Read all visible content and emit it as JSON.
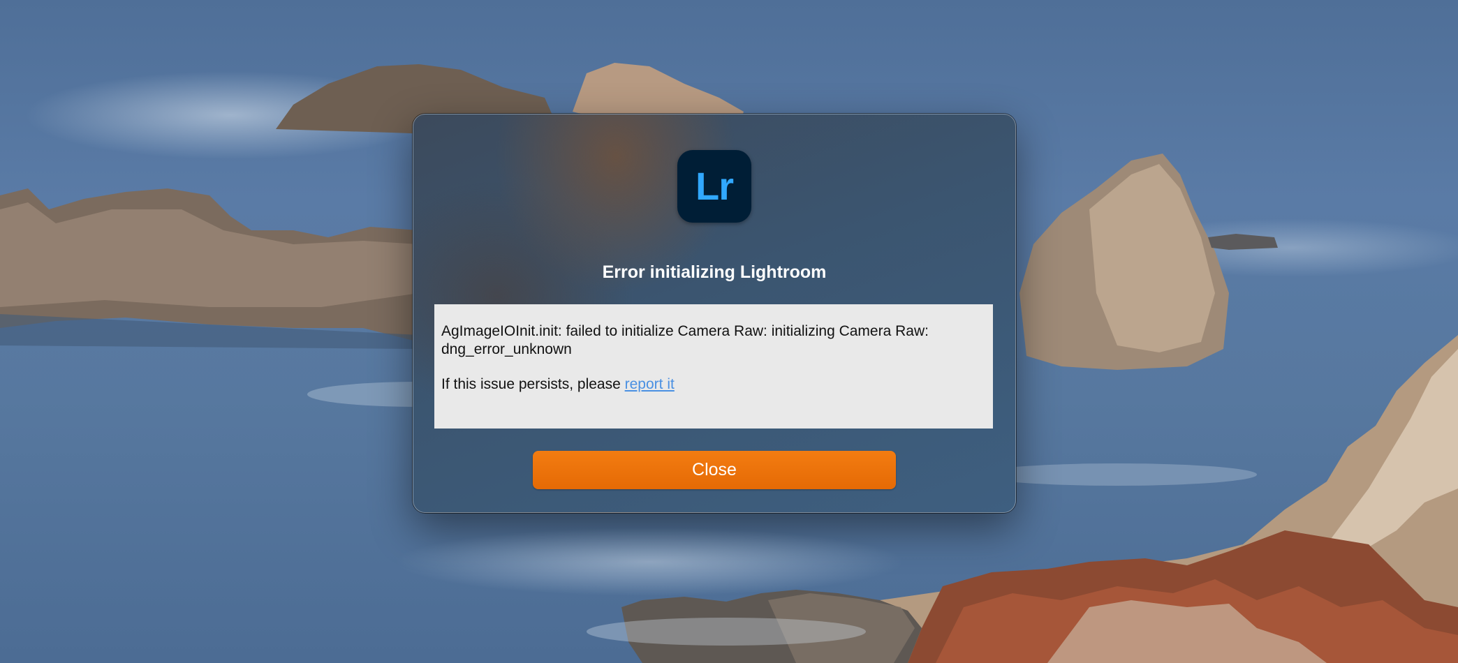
{
  "dialog": {
    "app_icon": {
      "icon": "lightroom-app-icon",
      "label": "Lr",
      "bg_color": "#001e36",
      "text_color": "#31a8ff"
    },
    "title": "Error initializing Lightroom",
    "message": {
      "line1": "AgImageIOInit.init: failed to initialize Camera Raw: initializing Camera Raw: dng_error_unknown",
      "line2_prefix": "If this issue persists, please ",
      "link_text": "report it"
    },
    "close_button": {
      "label": "Close",
      "color": "#ef7408"
    }
  }
}
